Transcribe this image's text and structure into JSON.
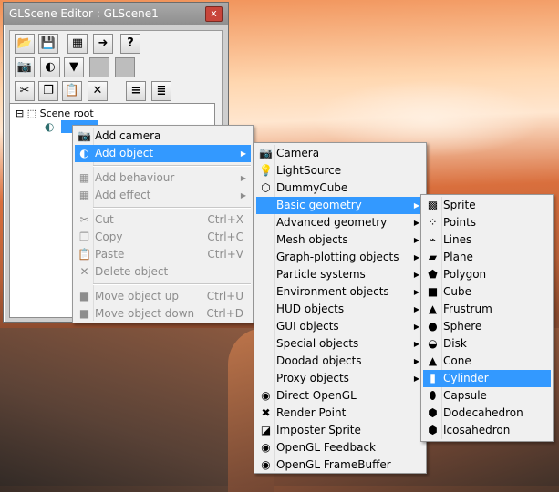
{
  "window": {
    "title": "GLScene Editor : GLScene1",
    "close_glyph": "x"
  },
  "toolbar": {
    "row1": [
      {
        "name": "open-icon",
        "glyph": "📂"
      },
      {
        "name": "save-icon",
        "glyph": "💾"
      },
      {
        "name": "grid-icon",
        "glyph": "▦"
      },
      {
        "name": "pin-icon",
        "glyph": "➜"
      },
      {
        "name": "help-icon",
        "glyph": "?"
      }
    ],
    "row2": [
      {
        "name": "camera-icon",
        "glyph": "📷"
      },
      {
        "name": "object-icon",
        "glyph": "◐"
      },
      {
        "name": "dropdown-icon",
        "glyph": "▼"
      },
      {
        "name": "disabled-1-icon",
        "glyph": ""
      },
      {
        "name": "disabled-2-icon",
        "glyph": ""
      }
    ],
    "row3": [
      {
        "name": "cut-icon",
        "glyph": "✂"
      },
      {
        "name": "copy-icon",
        "glyph": "❐"
      },
      {
        "name": "paste-icon",
        "glyph": "📋"
      },
      {
        "name": "delete-icon",
        "glyph": "✕"
      },
      {
        "name": "expand-icon",
        "glyph": "≡"
      },
      {
        "name": "collapse-icon",
        "glyph": "≣"
      }
    ]
  },
  "tree": {
    "root_label": "Scene root",
    "toggle": "⊟"
  },
  "context_menu": [
    {
      "label": "Add camera",
      "icon": "📷",
      "state": "normal"
    },
    {
      "label": "Add object",
      "icon": "◐",
      "state": "highlight",
      "submenu": true
    },
    {
      "sep": true
    },
    {
      "label": "Add behaviour",
      "icon": "▦",
      "state": "disabled",
      "submenu": true
    },
    {
      "label": "Add effect",
      "icon": "▦",
      "state": "disabled",
      "submenu": true
    },
    {
      "sep": true
    },
    {
      "label": "Cut",
      "icon": "✂",
      "state": "disabled",
      "shortcut": "Ctrl+X"
    },
    {
      "label": "Copy",
      "icon": "❐",
      "state": "disabled",
      "shortcut": "Ctrl+C"
    },
    {
      "label": "Paste",
      "icon": "📋",
      "state": "disabled",
      "shortcut": "Ctrl+V"
    },
    {
      "label": "Delete object",
      "icon": "✕",
      "state": "disabled"
    },
    {
      "sep": true
    },
    {
      "label": "Move object up",
      "icon": "■",
      "state": "disabled",
      "shortcut": "Ctrl+U"
    },
    {
      "label": "Move object down",
      "icon": "■",
      "state": "disabled",
      "shortcut": "Ctrl+D"
    }
  ],
  "object_menu": [
    {
      "label": "Camera",
      "icon": "📷",
      "state": "normal"
    },
    {
      "label": "LightSource",
      "icon": "💡",
      "state": "normal"
    },
    {
      "label": "DummyCube",
      "icon": "⬡",
      "state": "normal"
    },
    {
      "label": "Basic geometry",
      "icon": "",
      "state": "highlight",
      "submenu": true
    },
    {
      "label": "Advanced geometry",
      "icon": "",
      "state": "normal",
      "submenu": true
    },
    {
      "label": "Mesh objects",
      "icon": "",
      "state": "normal",
      "submenu": true
    },
    {
      "label": "Graph-plotting objects",
      "icon": "",
      "state": "normal",
      "submenu": true
    },
    {
      "label": "Particle systems",
      "icon": "",
      "state": "normal",
      "submenu": true
    },
    {
      "label": "Environment objects",
      "icon": "",
      "state": "normal",
      "submenu": true
    },
    {
      "label": "HUD objects",
      "icon": "",
      "state": "normal",
      "submenu": true
    },
    {
      "label": "GUI objects",
      "icon": "",
      "state": "normal",
      "submenu": true
    },
    {
      "label": "Special objects",
      "icon": "",
      "state": "normal",
      "submenu": true
    },
    {
      "label": "Doodad objects",
      "icon": "",
      "state": "normal",
      "submenu": true
    },
    {
      "label": "Proxy objects",
      "icon": "",
      "state": "normal",
      "submenu": true
    },
    {
      "label": "Direct OpenGL",
      "icon": "◉",
      "state": "normal"
    },
    {
      "label": "Render Point",
      "icon": "✖",
      "state": "normal"
    },
    {
      "label": "Imposter Sprite",
      "icon": "◪",
      "state": "normal"
    },
    {
      "label": "OpenGL Feedback",
      "icon": "◉",
      "state": "normal"
    },
    {
      "label": "OpenGL FrameBuffer",
      "icon": "◉",
      "state": "normal"
    }
  ],
  "geometry_menu": [
    {
      "label": "Sprite",
      "icon": "▩",
      "state": "normal"
    },
    {
      "label": "Points",
      "icon": "⁘",
      "state": "normal"
    },
    {
      "label": "Lines",
      "icon": "⌁",
      "state": "normal"
    },
    {
      "label": "Plane",
      "icon": "▰",
      "state": "normal"
    },
    {
      "label": "Polygon",
      "icon": "⬟",
      "state": "normal"
    },
    {
      "label": "Cube",
      "icon": "■",
      "state": "normal"
    },
    {
      "label": "Frustrum",
      "icon": "▲",
      "state": "normal"
    },
    {
      "label": "Sphere",
      "icon": "●",
      "state": "normal"
    },
    {
      "label": "Disk",
      "icon": "◒",
      "state": "normal"
    },
    {
      "label": "Cone",
      "icon": "▲",
      "state": "normal"
    },
    {
      "label": "Cylinder",
      "icon": "▮",
      "state": "highlight"
    },
    {
      "label": "Capsule",
      "icon": "⬮",
      "state": "normal"
    },
    {
      "label": "Dodecahedron",
      "icon": "⬢",
      "state": "normal"
    },
    {
      "label": "Icosahedron",
      "icon": "⬢",
      "state": "normal"
    }
  ],
  "submenu_arrow": "▶"
}
